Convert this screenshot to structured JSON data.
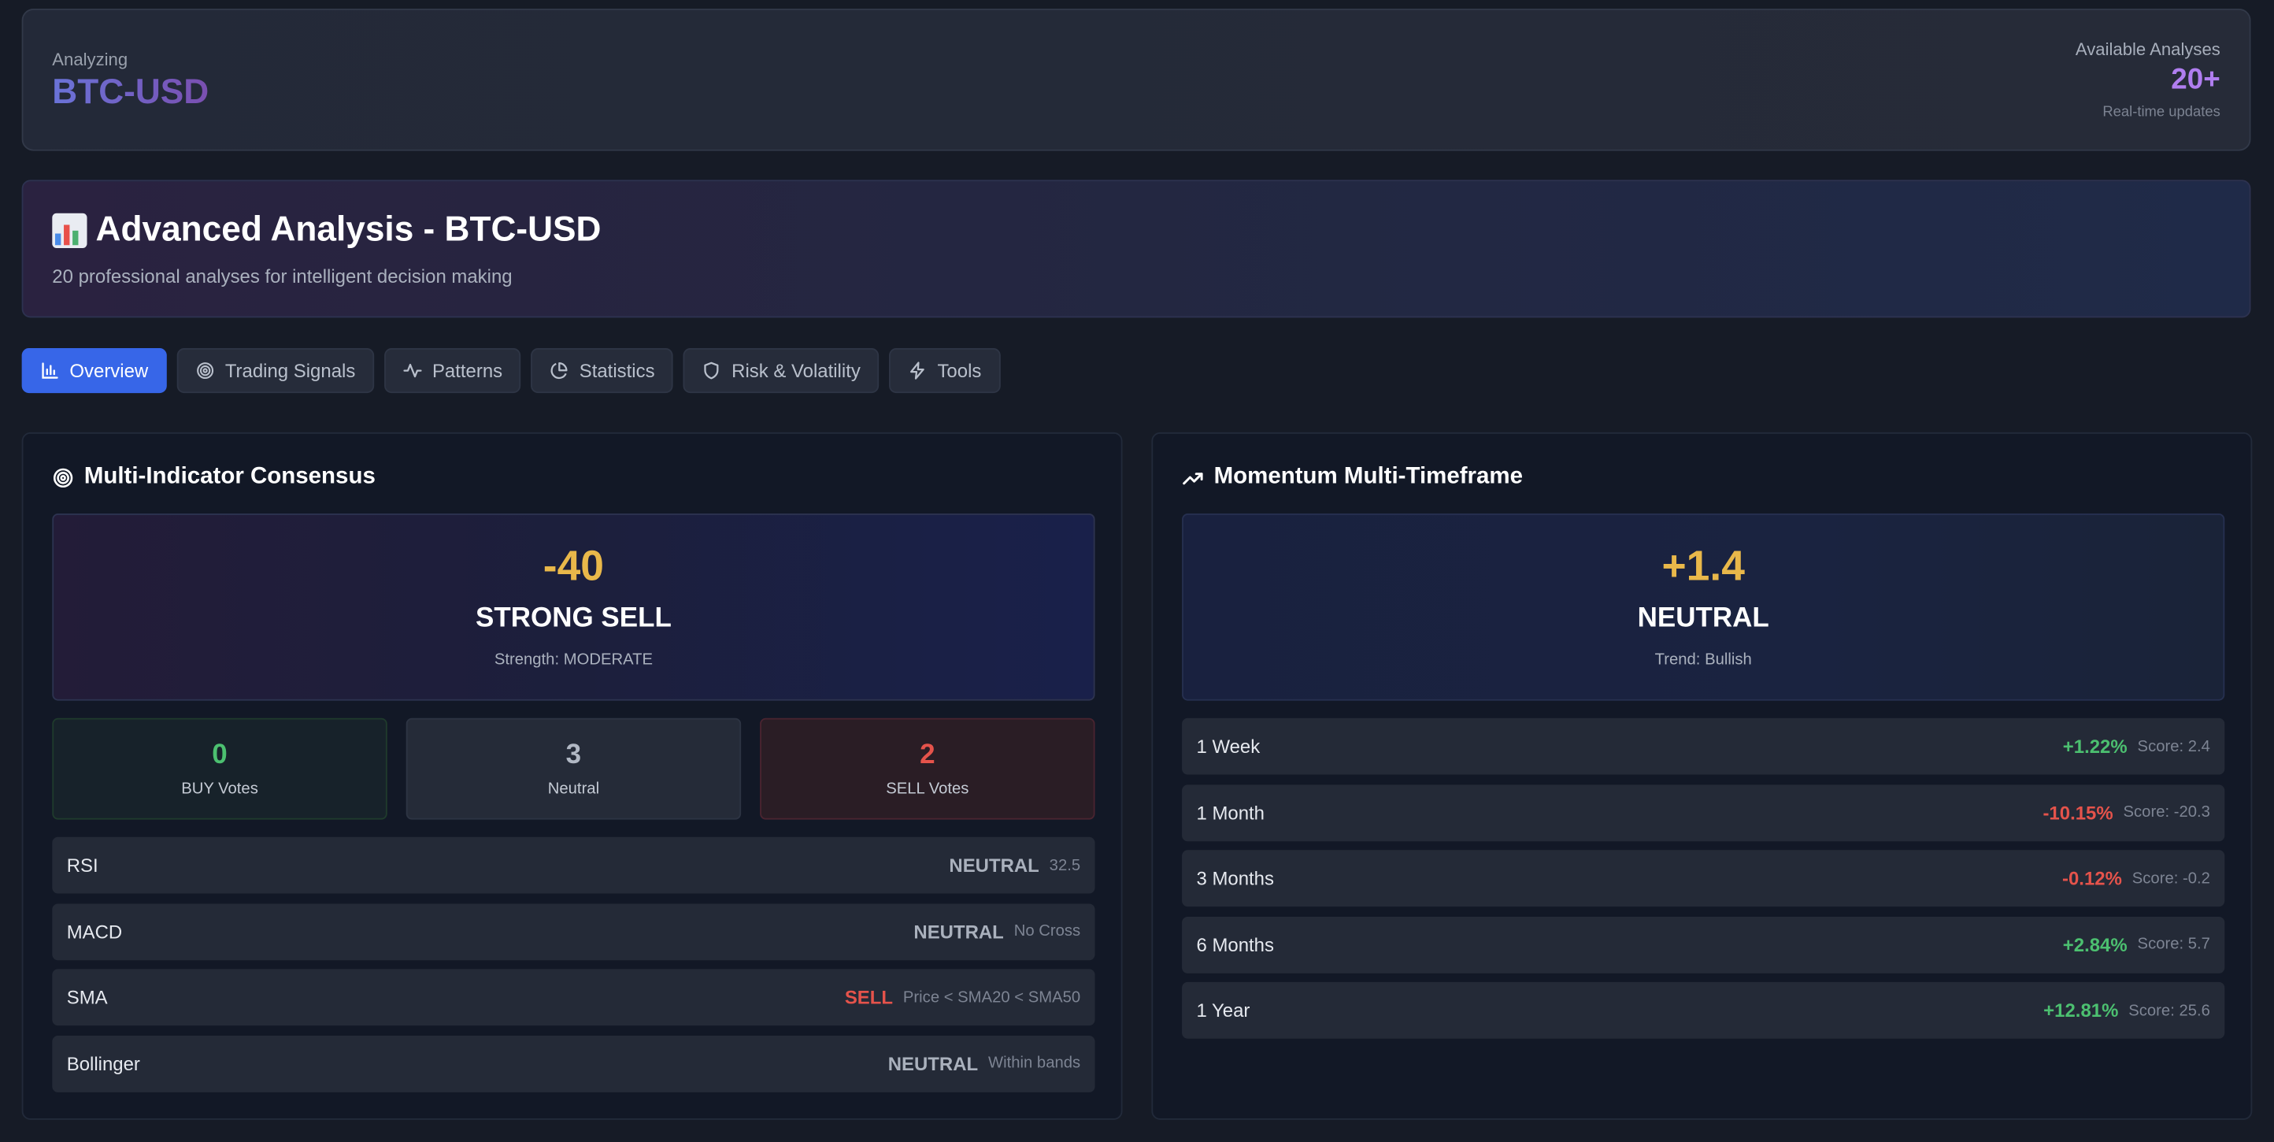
{
  "header": {
    "analyzing_label": "Analyzing",
    "ticker": "BTC-USD",
    "available_label": "Available Analyses",
    "available_count": "20+",
    "available_sub": "Real-time updates"
  },
  "hero": {
    "title": "Advanced Analysis - BTC-USD",
    "subtitle": "20 professional analyses for intelligent decision making",
    "icon": "bar-chart-emoji"
  },
  "tabs": [
    {
      "label": "Overview",
      "icon": "bar-chart-icon",
      "active": true
    },
    {
      "label": "Trading Signals",
      "icon": "target-icon",
      "active": false
    },
    {
      "label": "Patterns",
      "icon": "activity-icon",
      "active": false
    },
    {
      "label": "Statistics",
      "icon": "pie-chart-icon",
      "active": false
    },
    {
      "label": "Risk & Volatility",
      "icon": "shield-icon",
      "active": false
    },
    {
      "label": "Tools",
      "icon": "lightning-icon",
      "active": false
    }
  ],
  "consensus": {
    "title": "Multi-Indicator Consensus",
    "score": "-40",
    "signal": "STRONG SELL",
    "strength": "Strength: MODERATE",
    "votes": {
      "buy": {
        "count": "0",
        "label": "BUY Votes"
      },
      "neutral": {
        "count": "3",
        "label": "Neutral"
      },
      "sell": {
        "count": "2",
        "label": "SELL Votes"
      }
    },
    "indicators": [
      {
        "name": "RSI",
        "signal": "NEUTRAL",
        "detail": "32.5"
      },
      {
        "name": "MACD",
        "signal": "NEUTRAL",
        "detail": "No Cross"
      },
      {
        "name": "SMA",
        "signal": "SELL",
        "detail": "Price < SMA20 < SMA50"
      },
      {
        "name": "Bollinger",
        "signal": "NEUTRAL",
        "detail": "Within bands"
      }
    ]
  },
  "momentum": {
    "title": "Momentum Multi-Timeframe",
    "score": "+1.4",
    "signal": "NEUTRAL",
    "trend": "Trend: Bullish",
    "timeframes": [
      {
        "period": "1 Week",
        "change": "+1.22%",
        "score": "Score: 2.4"
      },
      {
        "period": "1 Month",
        "change": "-10.15%",
        "score": "Score: -20.3"
      },
      {
        "period": "3 Months",
        "change": "-0.12%",
        "score": "Score: -0.2"
      },
      {
        "period": "6 Months",
        "change": "+2.84%",
        "score": "Score: 5.7"
      },
      {
        "period": "1 Year",
        "change": "+12.81%",
        "score": "Score: 25.6"
      }
    ]
  },
  "colors": {
    "accent": "#3766e8",
    "gold": "#e9b84a",
    "positive": "#4cc070",
    "negative": "#e5534b",
    "purple": "#b07ef0"
  }
}
